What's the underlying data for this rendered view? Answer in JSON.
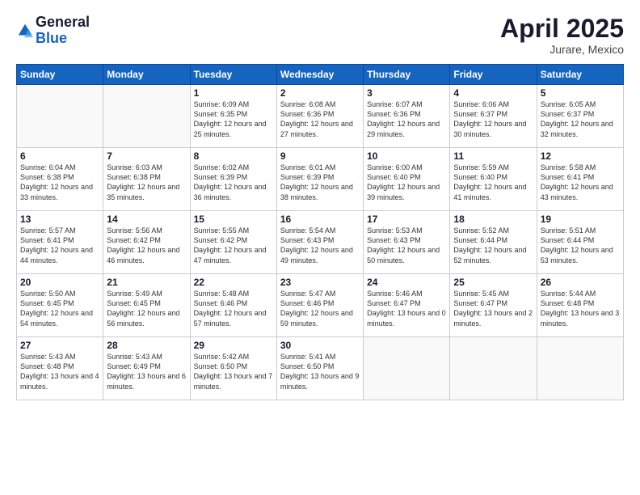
{
  "logo": {
    "general": "General",
    "blue": "Blue"
  },
  "title": "April 2025",
  "subtitle": "Jurare, Mexico",
  "weekdays": [
    "Sunday",
    "Monday",
    "Tuesday",
    "Wednesday",
    "Thursday",
    "Friday",
    "Saturday"
  ],
  "weeks": [
    [
      {
        "day": "",
        "empty": true
      },
      {
        "day": "",
        "empty": true
      },
      {
        "day": "1",
        "sunrise": "6:09 AM",
        "sunset": "6:35 PM",
        "daylight": "12 hours and 25 minutes."
      },
      {
        "day": "2",
        "sunrise": "6:08 AM",
        "sunset": "6:36 PM",
        "daylight": "12 hours and 27 minutes."
      },
      {
        "day": "3",
        "sunrise": "6:07 AM",
        "sunset": "6:36 PM",
        "daylight": "12 hours and 29 minutes."
      },
      {
        "day": "4",
        "sunrise": "6:06 AM",
        "sunset": "6:37 PM",
        "daylight": "12 hours and 30 minutes."
      },
      {
        "day": "5",
        "sunrise": "6:05 AM",
        "sunset": "6:37 PM",
        "daylight": "12 hours and 32 minutes."
      }
    ],
    [
      {
        "day": "6",
        "sunrise": "6:04 AM",
        "sunset": "6:38 PM",
        "daylight": "12 hours and 33 minutes."
      },
      {
        "day": "7",
        "sunrise": "6:03 AM",
        "sunset": "6:38 PM",
        "daylight": "12 hours and 35 minutes."
      },
      {
        "day": "8",
        "sunrise": "6:02 AM",
        "sunset": "6:39 PM",
        "daylight": "12 hours and 36 minutes."
      },
      {
        "day": "9",
        "sunrise": "6:01 AM",
        "sunset": "6:39 PM",
        "daylight": "12 hours and 38 minutes."
      },
      {
        "day": "10",
        "sunrise": "6:00 AM",
        "sunset": "6:40 PM",
        "daylight": "12 hours and 39 minutes."
      },
      {
        "day": "11",
        "sunrise": "5:59 AM",
        "sunset": "6:40 PM",
        "daylight": "12 hours and 41 minutes."
      },
      {
        "day": "12",
        "sunrise": "5:58 AM",
        "sunset": "6:41 PM",
        "daylight": "12 hours and 43 minutes."
      }
    ],
    [
      {
        "day": "13",
        "sunrise": "5:57 AM",
        "sunset": "6:41 PM",
        "daylight": "12 hours and 44 minutes."
      },
      {
        "day": "14",
        "sunrise": "5:56 AM",
        "sunset": "6:42 PM",
        "daylight": "12 hours and 46 minutes."
      },
      {
        "day": "15",
        "sunrise": "5:55 AM",
        "sunset": "6:42 PM",
        "daylight": "12 hours and 47 minutes."
      },
      {
        "day": "16",
        "sunrise": "5:54 AM",
        "sunset": "6:43 PM",
        "daylight": "12 hours and 49 minutes."
      },
      {
        "day": "17",
        "sunrise": "5:53 AM",
        "sunset": "6:43 PM",
        "daylight": "12 hours and 50 minutes."
      },
      {
        "day": "18",
        "sunrise": "5:52 AM",
        "sunset": "6:44 PM",
        "daylight": "12 hours and 52 minutes."
      },
      {
        "day": "19",
        "sunrise": "5:51 AM",
        "sunset": "6:44 PM",
        "daylight": "12 hours and 53 minutes."
      }
    ],
    [
      {
        "day": "20",
        "sunrise": "5:50 AM",
        "sunset": "6:45 PM",
        "daylight": "12 hours and 54 minutes."
      },
      {
        "day": "21",
        "sunrise": "5:49 AM",
        "sunset": "6:45 PM",
        "daylight": "12 hours and 56 minutes."
      },
      {
        "day": "22",
        "sunrise": "5:48 AM",
        "sunset": "6:46 PM",
        "daylight": "12 hours and 57 minutes."
      },
      {
        "day": "23",
        "sunrise": "5:47 AM",
        "sunset": "6:46 PM",
        "daylight": "12 hours and 59 minutes."
      },
      {
        "day": "24",
        "sunrise": "5:46 AM",
        "sunset": "6:47 PM",
        "daylight": "13 hours and 0 minutes."
      },
      {
        "day": "25",
        "sunrise": "5:45 AM",
        "sunset": "6:47 PM",
        "daylight": "13 hours and 2 minutes."
      },
      {
        "day": "26",
        "sunrise": "5:44 AM",
        "sunset": "6:48 PM",
        "daylight": "13 hours and 3 minutes."
      }
    ],
    [
      {
        "day": "27",
        "sunrise": "5:43 AM",
        "sunset": "6:48 PM",
        "daylight": "13 hours and 4 minutes."
      },
      {
        "day": "28",
        "sunrise": "5:43 AM",
        "sunset": "6:49 PM",
        "daylight": "13 hours and 6 minutes."
      },
      {
        "day": "29",
        "sunrise": "5:42 AM",
        "sunset": "6:50 PM",
        "daylight": "13 hours and 7 minutes."
      },
      {
        "day": "30",
        "sunrise": "5:41 AM",
        "sunset": "6:50 PM",
        "daylight": "13 hours and 9 minutes."
      },
      {
        "day": "",
        "empty": true
      },
      {
        "day": "",
        "empty": true
      },
      {
        "day": "",
        "empty": true
      }
    ]
  ]
}
